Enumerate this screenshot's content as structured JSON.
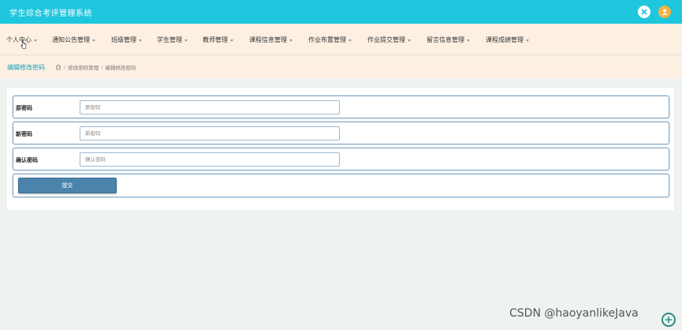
{
  "app": {
    "title": "学生综合考评管理系统",
    "accent_color": "#1ec6de",
    "user_avatar_color": "#f5b342"
  },
  "topbar": {
    "icons": [
      "close-icon",
      "user-icon"
    ]
  },
  "nav": {
    "items": [
      {
        "label": "个人中心"
      },
      {
        "label": "通知公告管理"
      },
      {
        "label": "班级管理"
      },
      {
        "label": "学生管理"
      },
      {
        "label": "教师管理"
      },
      {
        "label": "课程信息管理"
      },
      {
        "label": "作业布置管理"
      },
      {
        "label": "作业提交管理"
      },
      {
        "label": "留言信息管理"
      },
      {
        "label": "课程成绩管理"
      }
    ]
  },
  "page": {
    "heading": "编辑修改密码",
    "breadcrumb": [
      "修改密码管理",
      "编辑修改密码"
    ],
    "breadcrumb_separator": "/"
  },
  "form": {
    "old_password": {
      "label": "原密码",
      "placeholder": "原密码",
      "value": ""
    },
    "new_password": {
      "label": "新密码",
      "placeholder": "新密码",
      "value": ""
    },
    "confirm_password": {
      "label": "确认密码",
      "placeholder": "确认密码",
      "value": ""
    },
    "submit_label": "提交"
  },
  "watermark": {
    "text": "CSDN @haoyanlikeJava"
  }
}
